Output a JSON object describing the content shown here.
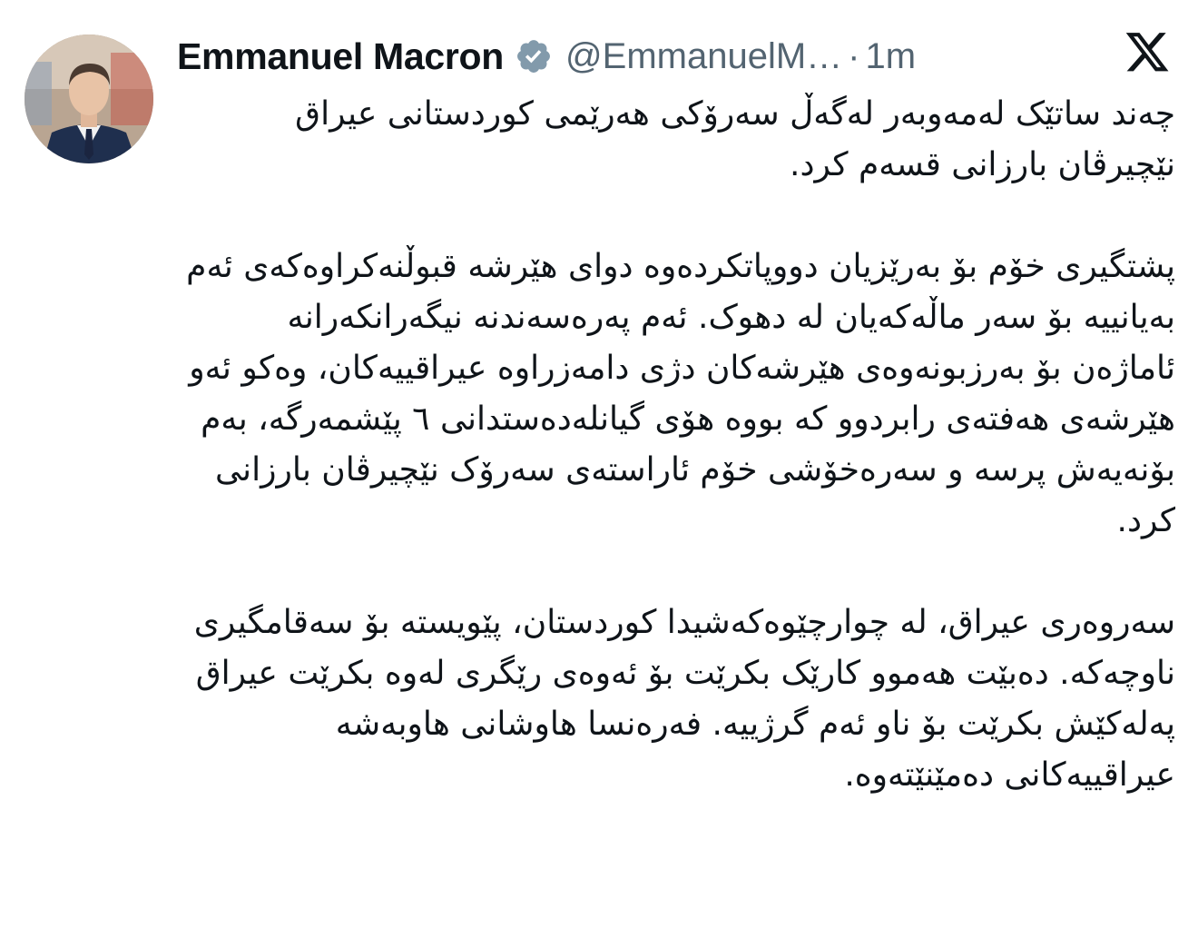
{
  "author": {
    "name": "Emmanuel Macron",
    "handle": "@EmmanuelM…",
    "separator": "·",
    "time": "1m",
    "verified_icon": "verified-badge-icon"
  },
  "platform_icon": "x-logo-icon",
  "colors": {
    "text": "#0f1419",
    "muted": "#536471",
    "verified": "#829aab",
    "background": "#ffffff"
  },
  "post": {
    "paragraphs": [
      "چەند ساتێک لەمەوبەر لەگەڵ سەرۆکی هەرێمی کوردستانی عیراق نێچیرڤان بارزانی قسەم کرد.",
      "پشتگیری خۆم بۆ بەرێزیان دووپاتکردەوە دوای هێرشە قبوڵنەکراوەکەی ئەم بەیانییە بۆ سەر ماڵەکەیان لە دهوک. ئەم پەرەسەندنە نیگەرانکەرانە ئاماژەن بۆ بەرزبونەوەی هێرشەکان دژی دامەزراوە عیراقییەکان، وەکو ئەو هێرشەی هەفتەی رابردوو کە بووە هۆی گیانلەدەستدانی ٦ پێشمەرگە، بەم بۆنەیەش پرسە و سەرەخۆشی خۆم ئاراستەی سەرۆک نێچیرڤان بارزانی کرد.",
      "سەروەری عیراق، لە چوارچێوەکەشیدا کوردستان، پێویستە بۆ سەقامگیری ناوچەکە. دەبێت هەموو کارێک بکرێت بۆ ئەوەی رێگری لەوە بکرێت عیراق پەلەکێش بکرێت بۆ ناو ئەم گرژییە. فەرەنسا هاوشانی هاوبەشە عیراقییەکانی دەمێنێتەوە."
    ]
  }
}
